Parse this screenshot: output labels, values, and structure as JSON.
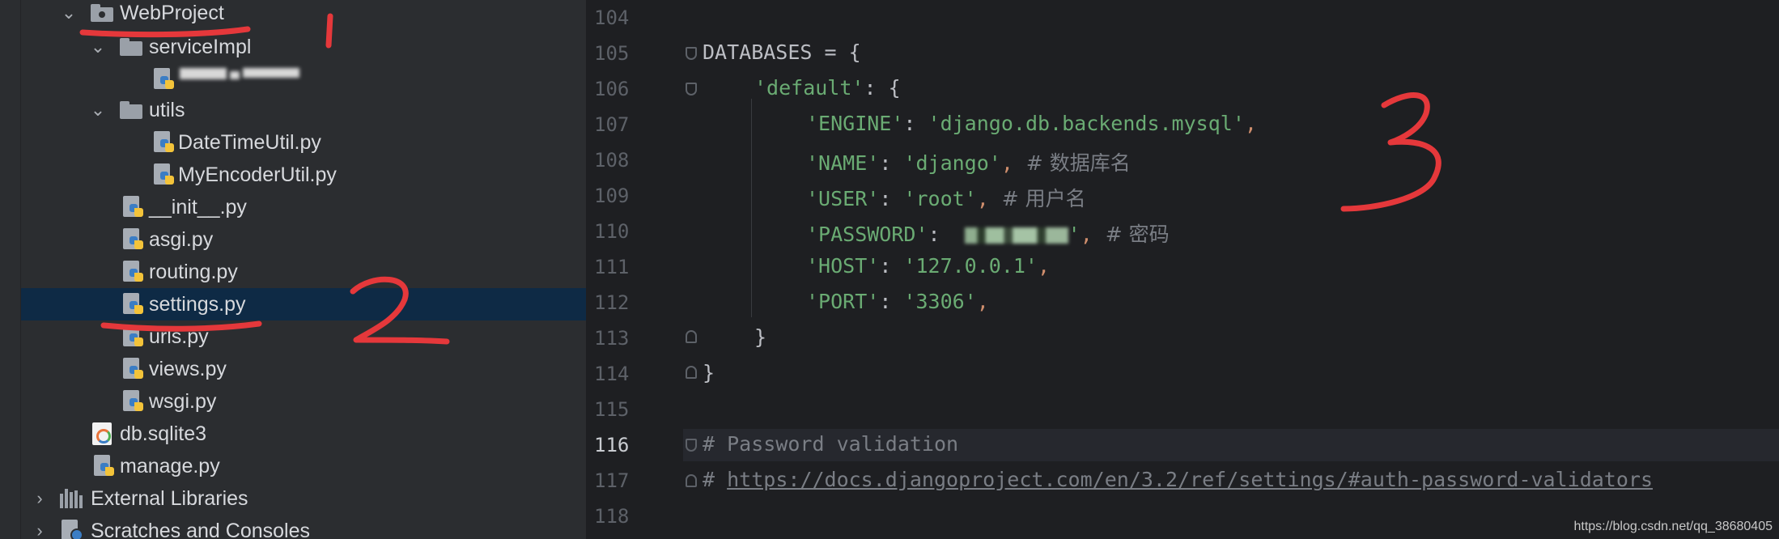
{
  "project_tree": {
    "items": [
      {
        "label": "WebProject",
        "kind": "folder-root",
        "expanded": true
      },
      {
        "label": "serviceImpl",
        "kind": "folder",
        "expanded": true
      },
      {
        "label": "",
        "kind": "py-blurred"
      },
      {
        "label": "utils",
        "kind": "folder",
        "expanded": true
      },
      {
        "label": "DateTimeUtil.py",
        "kind": "py"
      },
      {
        "label": "MyEncoderUtil.py",
        "kind": "py"
      },
      {
        "label": "__init__.py",
        "kind": "py"
      },
      {
        "label": "asgi.py",
        "kind": "py"
      },
      {
        "label": "routing.py",
        "kind": "py"
      },
      {
        "label": "settings.py",
        "kind": "py",
        "selected": true
      },
      {
        "label": "urls.py",
        "kind": "py"
      },
      {
        "label": "views.py",
        "kind": "py"
      },
      {
        "label": "wsgi.py",
        "kind": "py"
      },
      {
        "label": "db.sqlite3",
        "kind": "sqlite"
      },
      {
        "label": "manage.py",
        "kind": "py"
      },
      {
        "label": "External Libraries",
        "kind": "libraries",
        "expanded": false
      },
      {
        "label": "Scratches and Consoles",
        "kind": "scratches",
        "expanded": false
      }
    ]
  },
  "editor": {
    "current_line": "116",
    "line_numbers": [
      "104",
      "105",
      "106",
      "107",
      "108",
      "109",
      "110",
      "111",
      "112",
      "113",
      "114",
      "115",
      "116",
      "117",
      "118"
    ],
    "code": {
      "l105": {
        "name": "DATABASES",
        "op": " = {"
      },
      "l106": {
        "key": "'default'",
        "rest": ": {"
      },
      "l107": {
        "key": "'ENGINE'",
        "sep": ": ",
        "val": "'django.db.backends.mysql'",
        "comma": ","
      },
      "l108": {
        "key": "'NAME'",
        "sep": ": ",
        "val": "'django'",
        "comma": ",",
        "comment": "  # 数据库名"
      },
      "l109": {
        "key": "'USER'",
        "sep": ": ",
        "val": "'root'",
        "comma": ",",
        "comment": "  # 用户名"
      },
      "l110": {
        "key": "'PASSWORD'",
        "sep": ":  ",
        "val": "'",
        "comma": ",",
        "comment": "  # 密码"
      },
      "l111": {
        "key": "'HOST'",
        "sep": ": ",
        "val": "'127.0.0.1'",
        "comma": ","
      },
      "l112": {
        "key": "'PORT'",
        "sep": ": ",
        "val": "'3306'",
        "comma": ","
      },
      "l113": {
        "text": "}"
      },
      "l114": {
        "text": "}"
      },
      "l116": {
        "text": "# Password validation"
      },
      "l117": {
        "hash": "# ",
        "link": "https://docs.djangoproject.com/en/3.2/ref/settings/#auth-password-validators"
      }
    }
  },
  "annotations": {
    "labels": [
      "1",
      "2",
      "3"
    ],
    "color": "#e5383b"
  },
  "watermark": "https://blog.csdn.net/qq_38680405",
  "colors": {
    "tree_bg": "#2b2d30",
    "editor_bg": "#1e1f22",
    "selection": "#0e2a45",
    "string": "#6aab73",
    "punctuation": "#cf8e6d",
    "comment": "#7a7e85"
  }
}
